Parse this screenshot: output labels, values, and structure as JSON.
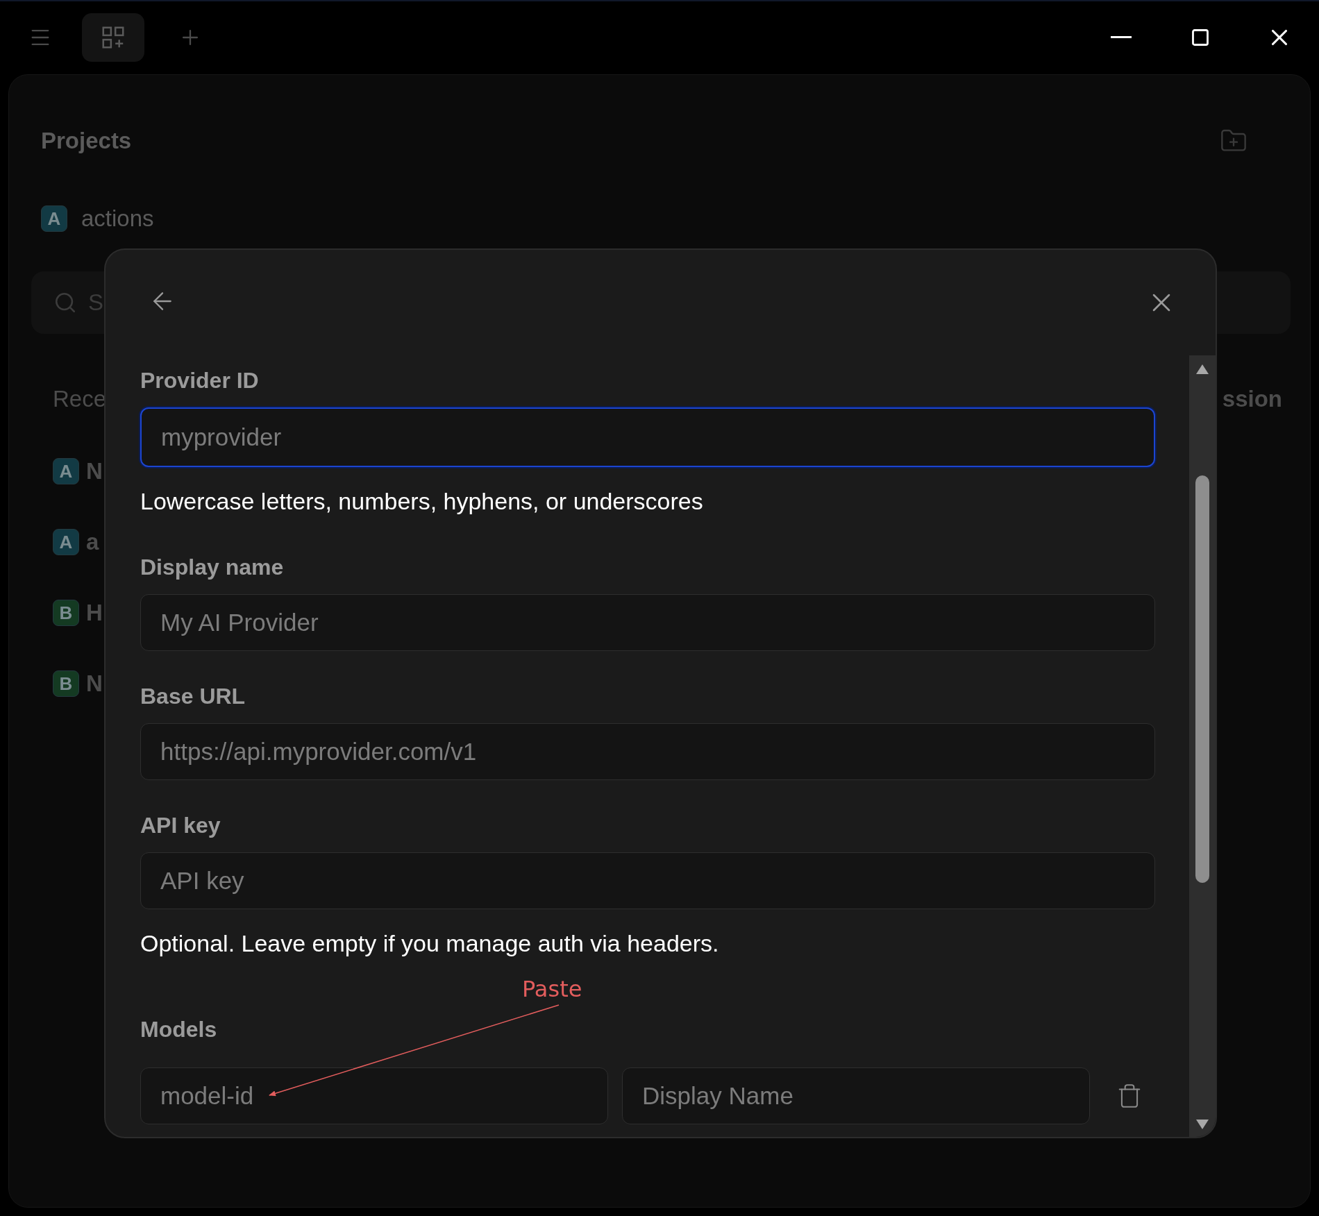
{
  "sidebar": {
    "title": "Projects",
    "projects": [
      {
        "badge": "A",
        "name": "actions",
        "color": "#123a44"
      }
    ],
    "search": {
      "placeholder": "S"
    },
    "recent_heading": "Rece",
    "column_2_heading": "ssion",
    "recent": [
      {
        "badge": "A",
        "name": "N",
        "color": "#123a44"
      },
      {
        "badge": "A",
        "name": "a",
        "color": "#123a44"
      },
      {
        "badge": "B",
        "name": "H",
        "color": "#143a22"
      },
      {
        "badge": "B",
        "name": "N",
        "color": "#143a22"
      }
    ]
  },
  "dialog": {
    "fields": [
      {
        "label": "Provider ID",
        "placeholder": "myprovider",
        "focused": true,
        "hint": "Lowercase letters, numbers, hyphens, or underscores"
      },
      {
        "label": "Display name",
        "placeholder": "My AI Provider",
        "focused": false
      },
      {
        "label": "Base URL",
        "placeholder": "https://api.myprovider.com/v1",
        "focused": false
      },
      {
        "label": "API key",
        "placeholder": "API key",
        "focused": false,
        "hint": "Optional. Leave empty if you manage auth via headers."
      }
    ],
    "models": {
      "label": "Models",
      "rows": [
        {
          "id_placeholder": "model-id",
          "name_placeholder": "Display Name"
        }
      ]
    },
    "annotation": {
      "text": "Paste"
    }
  }
}
